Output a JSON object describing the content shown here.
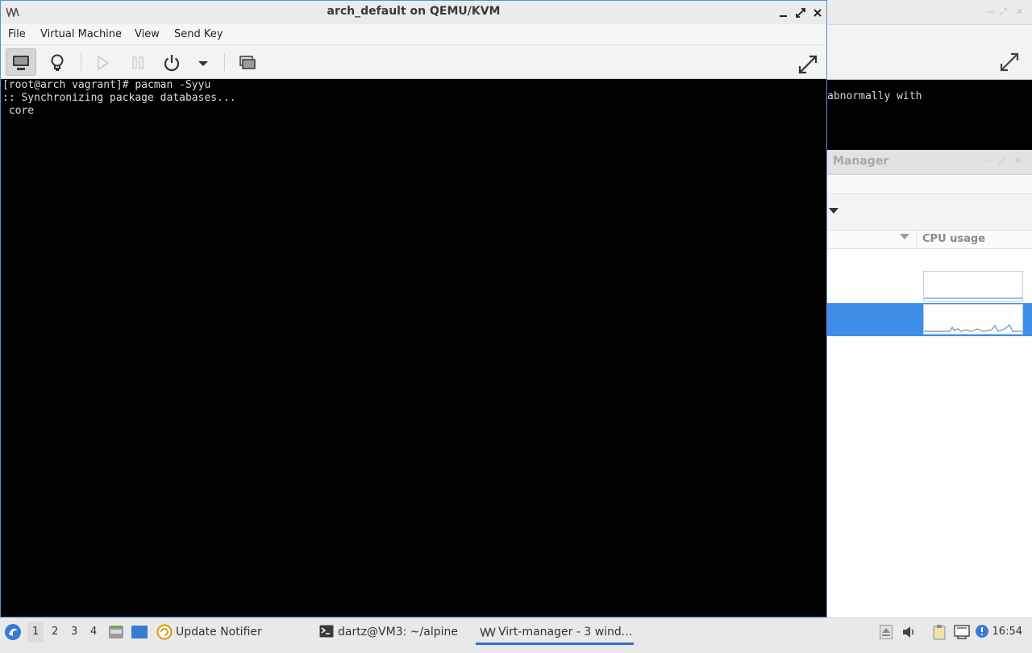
{
  "main_window": {
    "title": "arch_default on QEMU/KVM",
    "menu": [
      "File",
      "Virtual Machine",
      "View",
      "Send Key"
    ],
    "toolbar": {
      "show_console": "display-icon",
      "show_details": "lightbulb-icon",
      "run": "play-icon",
      "pause": "pause-icon",
      "shutdown": "power-icon",
      "shutdown_menu": "chevron-down-icon",
      "snapshots": "snapshots-icon",
      "fullscreen": "fullscreen-icon"
    },
    "console_lines": [
      "[root@arch vagrant]# pacman -Syyu",
      ":: Synchronizing package databases...",
      " core"
    ]
  },
  "background_terminal": {
    "visible_text": "abnormally with"
  },
  "virt_manager": {
    "title_fragment": "Manager",
    "column_header": "CPU usage"
  },
  "taskbar": {
    "workspaces": [
      "1",
      "2",
      "3",
      "4"
    ],
    "current_workspace": "1",
    "tasks": [
      {
        "label": "Update Notifier",
        "icon": "update-notifier-icon"
      },
      {
        "label": "dartz@VM3: ~/alpine",
        "icon": "terminal-icon"
      },
      {
        "label": "Virt-manager - 3 wind...",
        "icon": "virt-manager-icon"
      }
    ],
    "clock": "16:54"
  },
  "colors": {
    "selection": "#3d8ee8",
    "window_border": "#5c8ed8",
    "active_task_underline": "#2f6fd6"
  }
}
